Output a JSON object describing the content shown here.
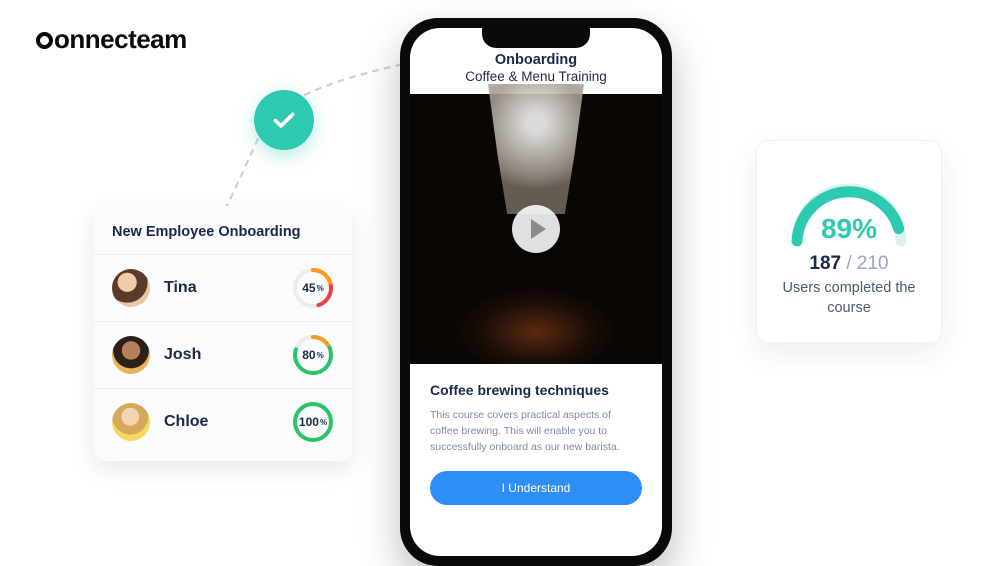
{
  "brand": "connecteam",
  "checkmark": true,
  "employee_card": {
    "title": "New Employee Onboarding",
    "rows": [
      {
        "name": "Tina",
        "percent": 45,
        "display": "45"
      },
      {
        "name": "Josh",
        "percent": 80,
        "display": "80"
      },
      {
        "name": "Chloe",
        "percent": 100,
        "display": "100"
      }
    ]
  },
  "phone": {
    "header_title": "Onboarding",
    "header_subtitle": "Coffee & Menu Training",
    "content_title": "Coffee brewing techniques",
    "content_body": "This course covers practical aspects of coffee brewing. This will enable you to successfully onboard as our new barista.",
    "cta_label": "I Understand"
  },
  "stats": {
    "percent_display": "89%",
    "percent": 89,
    "completed": "187",
    "separator": " / ",
    "total": "210",
    "label": "Users completed the course"
  }
}
